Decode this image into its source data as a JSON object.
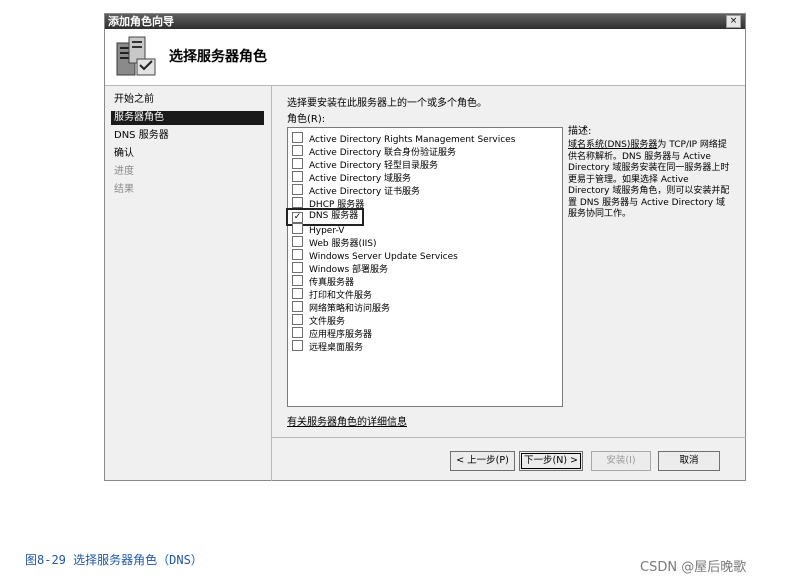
{
  "window": {
    "title": "添加角色向导",
    "close": "×"
  },
  "header": {
    "title": "选择服务器角色"
  },
  "nav": [
    {
      "label": "开始之前",
      "state": "normal"
    },
    {
      "label": "服务器角色",
      "state": "selected"
    },
    {
      "label": "DNS 服务器",
      "state": "normal"
    },
    {
      "label": "确认",
      "state": "normal"
    },
    {
      "label": "进度",
      "state": "disabled"
    },
    {
      "label": "结果",
      "state": "disabled"
    }
  ],
  "content": {
    "instruction": "选择要安装在此服务器上的一个或多个角色。",
    "roles_label": "角色(R):",
    "roles": [
      {
        "label": "Active Directory Rights Management Services",
        "checked": false
      },
      {
        "label": "Active Directory 联合身份验证服务",
        "checked": false
      },
      {
        "label": "Active Directory 轻型目录服务",
        "checked": false
      },
      {
        "label": "Active Directory 域服务",
        "checked": false
      },
      {
        "label": "Active Directory 证书服务",
        "checked": false
      },
      {
        "label": "DHCP 服务器",
        "checked": false
      },
      {
        "label": "DNS 服务器",
        "checked": true
      },
      {
        "label": "Hyper-V",
        "checked": false
      },
      {
        "label": "Web 服务器(IIS)",
        "checked": false
      },
      {
        "label": "Windows Server Update Services",
        "checked": false
      },
      {
        "label": "Windows 部署服务",
        "checked": false
      },
      {
        "label": "传真服务器",
        "checked": false
      },
      {
        "label": "打印和文件服务",
        "checked": false
      },
      {
        "label": "网络策略和访问服务",
        "checked": false
      },
      {
        "label": "文件服务",
        "checked": false
      },
      {
        "label": "应用程序服务器",
        "checked": false
      },
      {
        "label": "远程桌面服务",
        "checked": false
      }
    ],
    "description_title": "描述:",
    "description_link": "域名系统(DNS)服务器",
    "description_text": "为 TCP/IP 网络提供名称解析。DNS 服务器与 Active Directory 域服务安装在同一服务器上时更易于管理。如果选择 Active Directory 域服务角色，则可以安装并配置 DNS 服务器与 Active Directory 域服务协同工作。",
    "more_info_link": "有关服务器角色的详细信息"
  },
  "buttons": {
    "back": "< 上一步(P)",
    "next": "下一步(N) >",
    "install": "安装(I)",
    "cancel": "取消"
  },
  "caption": "图8-29 选择服务器角色（DNS）",
  "watermark": "CSDN @屋后晚歌"
}
